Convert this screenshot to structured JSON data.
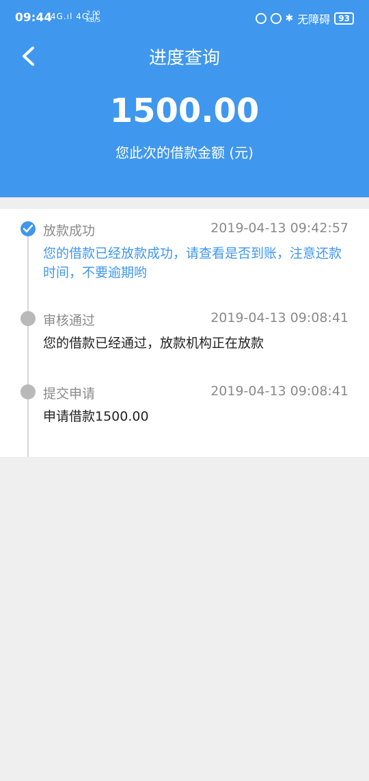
{
  "status_bar": {
    "time": "09:44",
    "signal": "4G.ıl 4G.ıl",
    "speed_value": "2.00",
    "speed_unit": "KB/S",
    "accessibility": "无障碍",
    "battery": "93"
  },
  "header": {
    "title": "进度查询",
    "amount": "1500.00",
    "amount_caption": "您此次的借款金额 (元)"
  },
  "timeline": [
    {
      "title": "放款成功",
      "time": "2019-04-13 09:42:57",
      "desc": "您的借款已经放款成功，请查看是否到账，注意还款时间，不要逾期哟",
      "status": "done"
    },
    {
      "title": "审核通过",
      "time": "2019-04-13 09:08:41",
      "desc": "您的借款已经通过，放款机构正在放款",
      "status": "pending"
    },
    {
      "title": "提交申请",
      "time": "2019-04-13 09:08:41",
      "desc": "申请借款1500.00",
      "status": "pending"
    }
  ],
  "colors": {
    "primary": "#3f97ee",
    "background": "#efefef",
    "inactive_dot": "#b9b9b9"
  }
}
